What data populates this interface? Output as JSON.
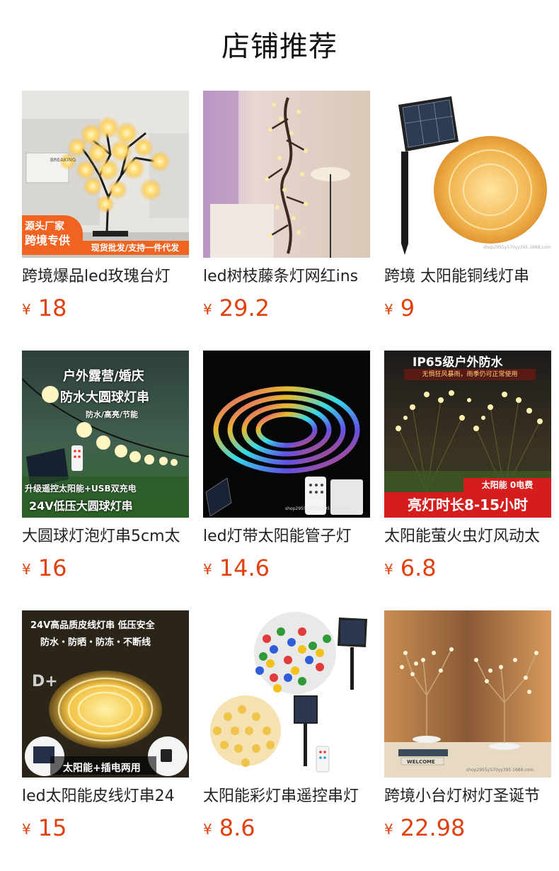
{
  "header": {
    "title": "店铺推荐"
  },
  "currency": "¥",
  "products": [
    {
      "title": "跨境爆品led玫瑰台灯",
      "price": "18",
      "badge_top": "源头厂家",
      "badge_bottom": "跨境专供",
      "strip": "现货批发/支持一件代发",
      "sign": "BREAKING"
    },
    {
      "title": "led树枝藤条灯网红ins",
      "price": "29.2"
    },
    {
      "title": "跨境 太阳能铜线灯串",
      "price": "9",
      "watermark": "shop2955y570yy395.1688.com"
    },
    {
      "title": "大圆球灯泡灯串5cm太",
      "price": "16",
      "line1": "户外露营/婚庆",
      "line2": "防水大圆球灯串",
      "line3": "防水/高亮/节能",
      "line4": "升级遥控太阳能+USB双充电",
      "line5": "24V低压大圆球灯串"
    },
    {
      "title": "led灯带太阳能管子灯",
      "price": "14.6",
      "watermark": "shop2955y570yy395.1688.com"
    },
    {
      "title": "太阳能萤火虫灯风动太",
      "price": "6.8",
      "headline": "IP65级户外防水",
      "subline": "无惧狂风暴雨，雨季仍可正常使用",
      "tag": "太阳能 0电费",
      "banner": "亮灯时长8-15小时"
    },
    {
      "title": "led太阳能皮线灯串24",
      "price": "15",
      "line1": "24V高品质皮线灯串 低压安全",
      "line2": "防水・防晒・防冻・不断线",
      "bottom": "太阳能+插电两用",
      "sign": "D+"
    },
    {
      "title": "太阳能彩灯串遥控串灯",
      "price": "8.6"
    },
    {
      "title": "跨境小台灯树灯圣诞节",
      "price": "22.98",
      "sign": "WELCOME",
      "watermark": "shop2955y570yy395.1688.com"
    }
  ]
}
